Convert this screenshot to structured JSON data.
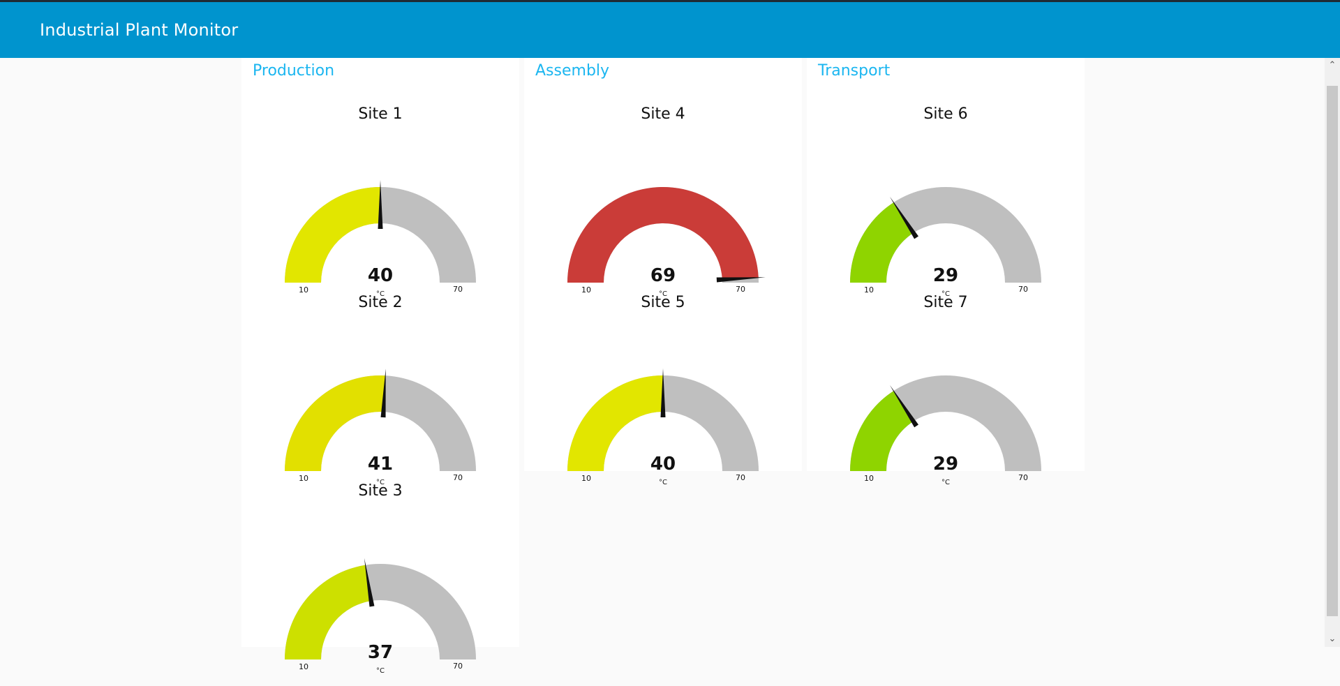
{
  "header": {
    "title": "Industrial Plant Monitor"
  },
  "colors": {
    "header_bg": "#0094ce",
    "group_title": "#1bb6f0",
    "track": "#bfbfbf",
    "needle": "#111111"
  },
  "groups": [
    {
      "title": "Production",
      "gauges": [
        {
          "label": "Site 1",
          "value": 40,
          "value_text": "40",
          "unit": "°C",
          "min": 10,
          "max": 70,
          "min_text": "10",
          "max_text": "70",
          "color": "#e2e600"
        },
        {
          "label": "Site 2",
          "value": 41,
          "value_text": "41",
          "unit": "°C",
          "min": 10,
          "max": 70,
          "min_text": "10",
          "max_text": "70",
          "color": "#e2e000"
        },
        {
          "label": "Site 3",
          "value": 37,
          "value_text": "37",
          "unit": "°C",
          "min": 10,
          "max": 70,
          "min_text": "10",
          "max_text": "70",
          "color": "#cde000"
        }
      ]
    },
    {
      "title": "Assembly",
      "gauges": [
        {
          "label": "Site 4",
          "value": 69,
          "value_text": "69",
          "unit": "°C",
          "min": 10,
          "max": 70,
          "min_text": "10",
          "max_text": "70",
          "color": "#ca3c38"
        },
        {
          "label": "Site 5",
          "value": 40,
          "value_text": "40",
          "unit": "°C",
          "min": 10,
          "max": 70,
          "min_text": "10",
          "max_text": "70",
          "color": "#e2e600"
        }
      ]
    },
    {
      "title": "Transport",
      "gauges": [
        {
          "label": "Site 6",
          "value": 29,
          "value_text": "29",
          "unit": "°C",
          "min": 10,
          "max": 70,
          "min_text": "10",
          "max_text": "70",
          "color": "#8fd400"
        },
        {
          "label": "Site 7",
          "value": 29,
          "value_text": "29",
          "unit": "°C",
          "min": 10,
          "max": 70,
          "min_text": "10",
          "max_text": "70",
          "color": "#8fd400"
        }
      ]
    }
  ],
  "scrollbar": {
    "up_icon": "chevron-up-icon",
    "down_icon": "chevron-down-icon"
  }
}
